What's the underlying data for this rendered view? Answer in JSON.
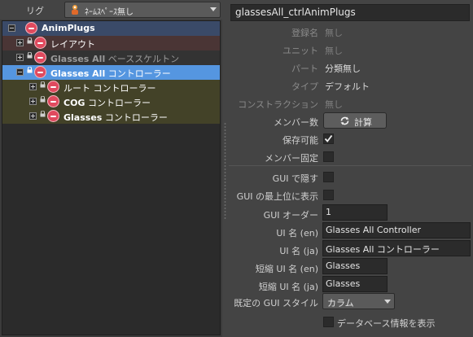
{
  "rig": {
    "label": "リグ",
    "value": "ﾈｰﾑｽﾍﾟｰｽ無し",
    "icon": "rig-icon"
  },
  "tree": {
    "items": [
      {
        "name": "AnimPlugs",
        "suffix": "",
        "color": "#ffffff",
        "bold": true,
        "row_bg": "#3a4a68"
      },
      {
        "name": "レイアウト",
        "suffix": "",
        "color": "#ffffff",
        "bold": false,
        "row_bg": "#4a3535"
      },
      {
        "name": "Glasses All",
        "suffix": " ベーススケルトン",
        "color": "#9a9a9a",
        "bold": true,
        "row_bg": "#333333"
      },
      {
        "name": "Glasses All",
        "suffix": " コントローラー",
        "color": "#ffffff",
        "bold": true,
        "row_bg": "#5596e0"
      },
      {
        "name": "ルート コントローラー",
        "suffix": "",
        "color": "#ffffff",
        "bold": false,
        "row_bg": "#434228"
      },
      {
        "name": "COG",
        "suffix": " コントローラー",
        "color": "#ffffff",
        "bold": true,
        "row_bg": "#434228"
      },
      {
        "name": "Glasses",
        "suffix": " コントローラー",
        "color": "#ffffff",
        "bold": true,
        "row_bg": "#434228"
      }
    ]
  },
  "node_name": "glassesAll_ctrlAnimPlugs",
  "fields": {
    "registered_name": {
      "label": "登録名",
      "value": "無し"
    },
    "unit": {
      "label": "ユニット",
      "value": "無し"
    },
    "part": {
      "label": "パート",
      "value": "分類無し"
    },
    "type": {
      "label": "タイプ",
      "value": "デフォルト"
    },
    "construction": {
      "label": "コンストラクション",
      "value": "無し"
    },
    "member_count": {
      "label": "メンバー数",
      "button": "計算"
    },
    "savable": {
      "label": "保存可能",
      "checked": true
    },
    "member_fixed": {
      "label": "メンバー固定",
      "checked": false
    },
    "gui_hide": {
      "label": "GUI で隠す",
      "checked": false
    },
    "gui_top": {
      "label": "GUI の最上位に表示",
      "checked": false
    },
    "gui_order": {
      "label": "GUI オーダー",
      "value": "1"
    },
    "ui_name_en": {
      "label": "UI 名 (en)",
      "value": "Glasses All Controller"
    },
    "ui_name_ja": {
      "label": "UI 名 (ja)",
      "value": "Glasses All コントローラー"
    },
    "short_ui_name_en": {
      "label": "短縮 UI 名 (en)",
      "value": "Glasses"
    },
    "short_ui_name_ja": {
      "label": "短縮 UI 名 (ja)",
      "value": "Glasses"
    },
    "gui_style": {
      "label": "既定の GUI スタイル",
      "value": "カラム"
    },
    "show_db_info": {
      "label": "データベース情報を表示",
      "checked": false
    }
  },
  "colors": {
    "node_icon": "#e04a5e",
    "selection": "#5596e0"
  }
}
